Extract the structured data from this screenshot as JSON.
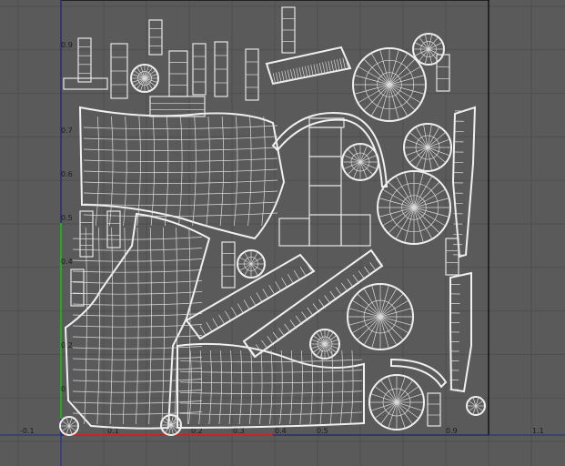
{
  "editor": {
    "name": "UV Texture Editor",
    "background_color": "#5a5a5a",
    "grid_color": "#4d4d4d",
    "wire_color": "#e6e6e6",
    "frame_color": "#000000",
    "axis_u_color": "#cc2222",
    "axis_v_color": "#22aa22",
    "axis_origin_color": "#2233cc"
  },
  "axes": {
    "u_ticks": [
      "-0.1",
      "0.1",
      "0.2",
      "0.3",
      "0.4",
      "0.5",
      "0.9",
      "1.1"
    ],
    "v_ticks": [
      "0.9",
      "0.7",
      "0.6",
      "0.5",
      "0.4",
      "0.2",
      "0"
    ]
  },
  "uv_shells": [
    {
      "id": "torso-front",
      "shape": "grid-patch"
    },
    {
      "id": "torso-back",
      "shape": "grid-patch"
    },
    {
      "id": "skirt",
      "shape": "grid-patch"
    },
    {
      "id": "hem",
      "shape": "grid-patch"
    },
    {
      "id": "sleeve-strip-1",
      "shape": "strip"
    },
    {
      "id": "sleeve-strip-2",
      "shape": "strip"
    },
    {
      "id": "belt",
      "shape": "strip"
    },
    {
      "id": "wheel-large-1",
      "shape": "radial"
    },
    {
      "id": "wheel-large-2",
      "shape": "radial"
    },
    {
      "id": "wheel-medium",
      "shape": "radial"
    },
    {
      "id": "gear-1",
      "shape": "radial"
    },
    {
      "id": "gear-2",
      "shape": "radial"
    },
    {
      "id": "boxes",
      "shape": "grid"
    },
    {
      "id": "fingers",
      "shape": "strip"
    }
  ]
}
